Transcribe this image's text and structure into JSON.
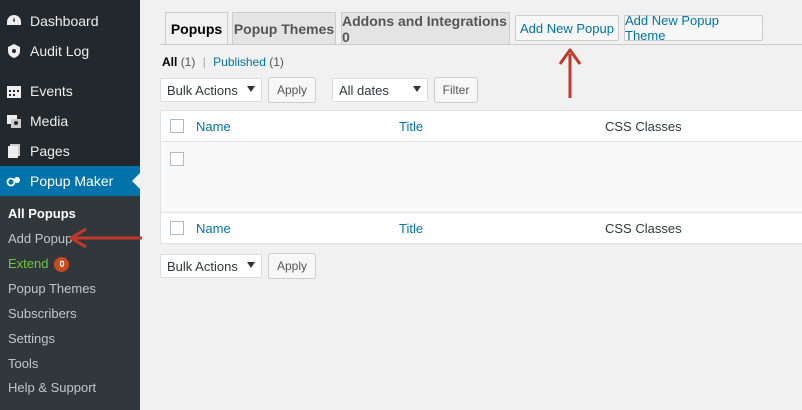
{
  "sidebar": {
    "menu": [
      {
        "label": "Dashboard",
        "icon": "dashboard-icon"
      },
      {
        "label": "Audit Log",
        "icon": "shield-icon"
      },
      {
        "label": "Events",
        "icon": "calendar-icon"
      },
      {
        "label": "Media",
        "icon": "media-icon"
      },
      {
        "label": "Pages",
        "icon": "pages-icon"
      },
      {
        "label": "Popup Maker",
        "icon": "popup-maker-icon"
      }
    ],
    "submenu": [
      {
        "label": "All Popups"
      },
      {
        "label": "Add Popup"
      },
      {
        "label": "Extend",
        "badge": "0"
      },
      {
        "label": "Popup Themes"
      },
      {
        "label": "Subscribers"
      },
      {
        "label": "Settings"
      },
      {
        "label": "Tools"
      },
      {
        "label": "Help & Support"
      }
    ]
  },
  "tabs": [
    {
      "label": "Popups"
    },
    {
      "label": "Popup Themes"
    },
    {
      "label": "Addons and Integrations 0"
    }
  ],
  "actions": {
    "add_new_popup": "Add New Popup",
    "add_new_popup_theme": "Add New Popup Theme"
  },
  "filters": {
    "all": "All",
    "all_count": "(1)",
    "published": "Published",
    "published_count": "(1)",
    "separator": "|"
  },
  "controls": {
    "bulk_actions": "Bulk Actions",
    "apply": "Apply",
    "all_dates": "All dates",
    "filter": "Filter"
  },
  "table": {
    "columns": [
      "Name",
      "Title",
      "CSS Classes"
    ]
  },
  "colors": {
    "sidebar_bg": "#23282d",
    "active_bg": "#0073aa",
    "link": "#0073aa",
    "annotation_arrow": "#c0392b"
  }
}
